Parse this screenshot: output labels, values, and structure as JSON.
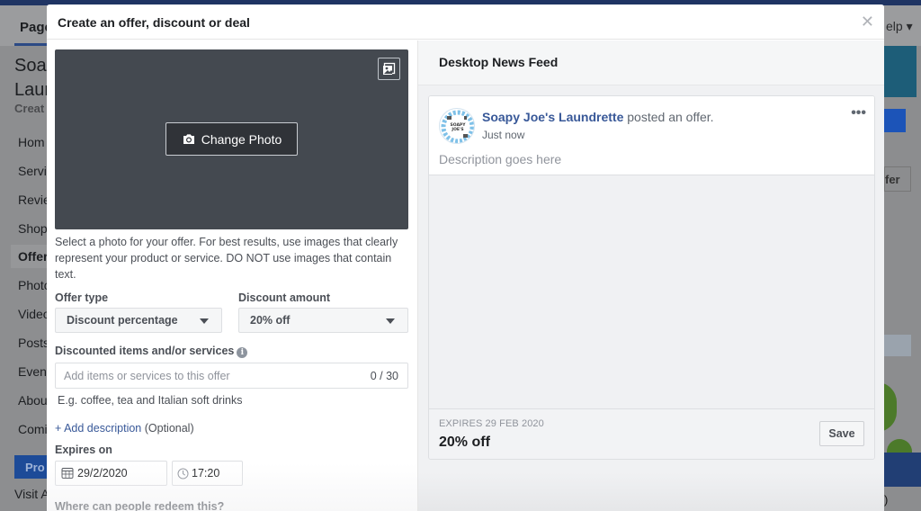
{
  "background_page": {
    "tab_label": "Page",
    "help_label": "elp ▾",
    "page_title_line1": "Soap",
    "page_title_line2": "Laur",
    "create_label": "Creat",
    "nav_items": [
      {
        "label": "Hom",
        "active": false
      },
      {
        "label": "Servi",
        "active": false
      },
      {
        "label": "Revie",
        "active": false
      },
      {
        "label": "Shop",
        "active": false
      },
      {
        "label": "Offer",
        "active": true
      },
      {
        "label": "Photo",
        "active": false
      },
      {
        "label": "Video",
        "active": false
      },
      {
        "label": "Posts",
        "active": false
      },
      {
        "label": "Even",
        "active": false
      },
      {
        "label": "Abou",
        "active": false
      },
      {
        "label": "Comi",
        "active": false
      }
    ],
    "promote_label": "Pro",
    "visit_label": "Visit A",
    "right_offer_label": "fer",
    "right_paren": ")"
  },
  "modal": {
    "title": "Create an offer, discount or deal",
    "close_icon": "close-icon",
    "photo": {
      "change_photo_label": "Change Photo",
      "help_text": "Select a photo for your offer. For best results, use images that clearly represent your product or service. DO NOT use images that contain text."
    },
    "offer_type": {
      "label": "Offer type",
      "selected": "Discount percentage"
    },
    "discount_amount": {
      "label": "Discount amount",
      "selected": "20% off"
    },
    "discounted_items": {
      "label": "Discounted items and/or services",
      "info_icon": "i",
      "placeholder": "Add items or services to this offer",
      "value": "",
      "counter": "0 / 30",
      "example": "E.g. coffee, tea and Italian soft drinks"
    },
    "add_description": {
      "link_label": "+ Add description",
      "optional_label": "(Optional)"
    },
    "expires_on": {
      "label": "Expires on",
      "date": "29/2/2020",
      "time": "17:20"
    },
    "redeem_label": "Where can people redeem this?",
    "preview": {
      "header": "Desktop News Feed",
      "page_name": "Soapy Joe's Laundrette",
      "action_text": "posted an offer.",
      "timestamp": "Just now",
      "avatar_text": [
        "SOAPY",
        "JOE'S"
      ],
      "description": "Description goes here",
      "expires_text": "EXPIRES 29 FEB 2020",
      "offer_amount": "20% off",
      "save_label": "Save",
      "more_label": "•••"
    }
  }
}
